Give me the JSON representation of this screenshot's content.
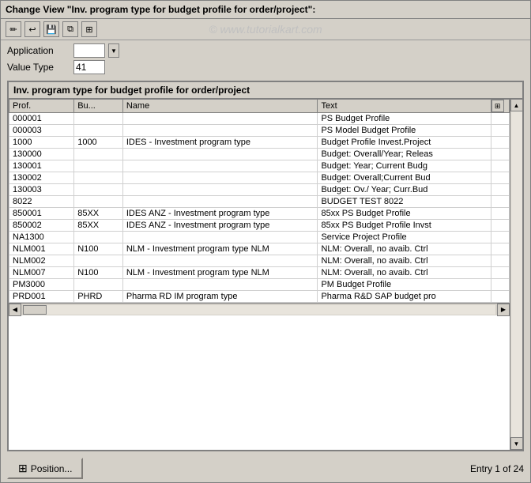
{
  "window": {
    "title": "Change View \"Inv. program type for budget profile for order/project\":"
  },
  "toolbar": {
    "watermark": "© www.tutorialkart.com",
    "buttons": [
      "edit",
      "back",
      "save",
      "copy",
      "display-change"
    ]
  },
  "form": {
    "application_label": "Application",
    "application_value": "",
    "value_type_label": "Value Type",
    "value_type_value": "41"
  },
  "table": {
    "title": "Inv. program type for budget profile for order/project",
    "columns": [
      {
        "key": "prof",
        "label": "Prof."
      },
      {
        "key": "bu",
        "label": "Bu..."
      },
      {
        "key": "name",
        "label": "Name"
      },
      {
        "key": "text",
        "label": "Text"
      }
    ],
    "rows": [
      {
        "prof": "000001",
        "bu": "",
        "name": "",
        "text": "PS Budget Profile"
      },
      {
        "prof": "000003",
        "bu": "",
        "name": "",
        "text": "PS Model Budget Profile"
      },
      {
        "prof": "1000",
        "bu": "1000",
        "name": "IDES - Investment program type",
        "text": "Budget Profile Invest.Project"
      },
      {
        "prof": "130000",
        "bu": "",
        "name": "",
        "text": "Budget: Overall/Year; Releas"
      },
      {
        "prof": "130001",
        "bu": "",
        "name": "",
        "text": "Budget: Year; Current Budg"
      },
      {
        "prof": "130002",
        "bu": "",
        "name": "",
        "text": "Budget: Overall;Current Bud"
      },
      {
        "prof": "130003",
        "bu": "",
        "name": "",
        "text": "Budget: Ov./ Year; Curr.Bud"
      },
      {
        "prof": "8022",
        "bu": "",
        "name": "",
        "text": "BUDGET TEST 8022"
      },
      {
        "prof": "850001",
        "bu": "85XX",
        "name": "IDES ANZ - Investment program type",
        "text": "85xx PS Budget Profile"
      },
      {
        "prof": "850002",
        "bu": "85XX",
        "name": "IDES ANZ - Investment program type",
        "text": "85xx PS Budget Profile Invst"
      },
      {
        "prof": "NA1300",
        "bu": "",
        "name": "",
        "text": "Service Project Profile"
      },
      {
        "prof": "NLM001",
        "bu": "N100",
        "name": "NLM - Investment program type NLM",
        "text": "NLM: Overall, no avaib. Ctrl"
      },
      {
        "prof": "NLM002",
        "bu": "",
        "name": "",
        "text": "NLM: Overall, no avaib. Ctrl"
      },
      {
        "prof": "NLM007",
        "bu": "N100",
        "name": "NLM - Investment program type NLM",
        "text": "NLM: Overall, no avaib. Ctrl"
      },
      {
        "prof": "PM3000",
        "bu": "",
        "name": "",
        "text": "PM Budget Profile"
      },
      {
        "prof": "PRD001",
        "bu": "PHRD",
        "name": "Pharma RD IM program type",
        "text": "Pharma R&D SAP budget pro"
      }
    ]
  },
  "bottom": {
    "position_label": "Position...",
    "entry_text": "Entry 1 of 24"
  }
}
